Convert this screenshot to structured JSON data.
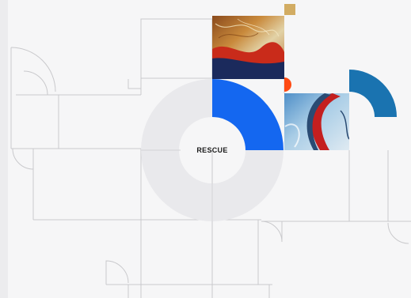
{
  "center": {
    "label": "RESCUE"
  },
  "colors": {
    "background": "#f6f6f7",
    "line": "#c9c9cc",
    "ring": "#e9e9ec",
    "blue": "#1467f0",
    "steel_blue": "#1a73b0",
    "orange": "#ff4a12",
    "gold": "#d2ac63"
  },
  "images": [
    {
      "name": "textured-painting-image",
      "description_palette": [
        "#b06728",
        "#d9c291",
        "#c42a18",
        "#1c2a5a"
      ]
    },
    {
      "name": "blue-red-abstract-image",
      "description_palette": [
        "#7fb6dc",
        "#d8e7f0",
        "#c41f1f",
        "#2a4b73"
      ]
    }
  ]
}
